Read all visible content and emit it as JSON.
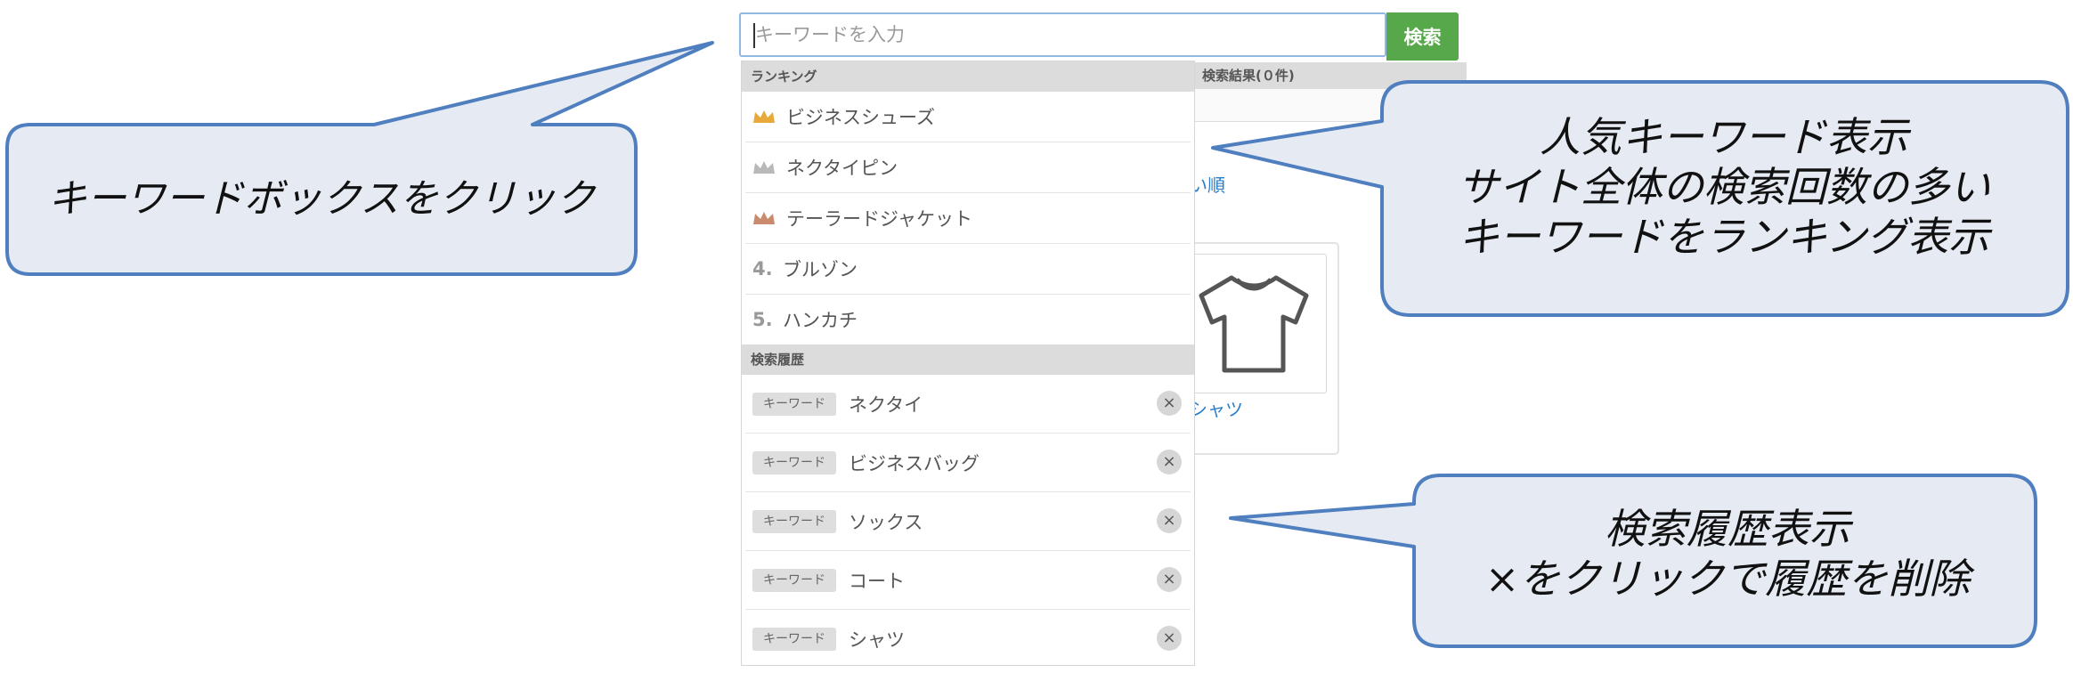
{
  "search": {
    "placeholder": "キーワードを入力",
    "button_label": "検索"
  },
  "results": {
    "header": "検索結果(０件)",
    "sort_fragment": "い順",
    "product_name_fragment": "シャツ"
  },
  "ranking": {
    "header": "ランキング",
    "items": [
      {
        "rank": "1",
        "label": "ビジネスシューズ",
        "icon": "gold-crown-icon",
        "color": "#e8a93a"
      },
      {
        "rank": "2",
        "label": "ネクタイピン",
        "icon": "silver-crown-icon",
        "color": "#b9b9b9"
      },
      {
        "rank": "3",
        "label": "テーラードジャケット",
        "icon": "bronze-crown-icon",
        "color": "#c98a6e"
      },
      {
        "rank": "4.",
        "label": "ブルゾン"
      },
      {
        "rank": "5.",
        "label": "ハンカチ"
      }
    ]
  },
  "history": {
    "header": "検索履歴",
    "badge_label": "キーワード",
    "remove_icon": "×",
    "items": [
      {
        "label": "ネクタイ"
      },
      {
        "label": "ビジネスバッグ"
      },
      {
        "label": "ソックス"
      },
      {
        "label": "コート"
      },
      {
        "label": "シャツ"
      }
    ]
  },
  "callouts": {
    "click_box": "キーワードボックスをクリック",
    "popular": [
      "人気キーワード表示",
      "サイト全体の検索回数の多い",
      "キーワードをランキング表示"
    ],
    "history": [
      "検索履歴表示",
      "×をクリックで履歴を削除"
    ]
  },
  "colors": {
    "search_button": "#57a84a",
    "callout_fill": "#e6ebf3",
    "callout_border": "#4f7fbf",
    "link": "#2a7cc7"
  }
}
